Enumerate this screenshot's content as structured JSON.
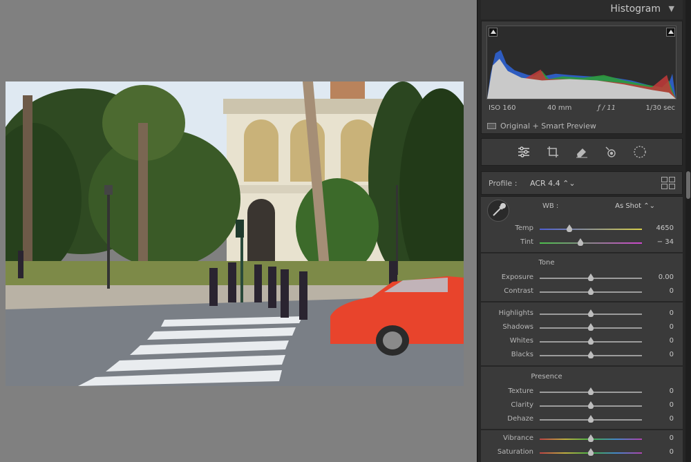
{
  "histogram": {
    "title": "Histogram",
    "iso": "ISO 160",
    "focal_length": "40 mm",
    "aperture": "ƒ / 11",
    "shutter": "1/30 sec",
    "preview_status": "Original + Smart Preview"
  },
  "tools": [
    {
      "name": "edit-sliders-icon"
    },
    {
      "name": "crop-icon"
    },
    {
      "name": "heal-eraser-icon"
    },
    {
      "name": "red-eye-icon"
    },
    {
      "name": "masking-icon"
    }
  ],
  "profile": {
    "label": "Profile :",
    "value": "ACR 4.4 ⌃⌄"
  },
  "wb": {
    "label": "WB :",
    "value": "As Shot ⌃⌄"
  },
  "groups": {
    "tone": "Tone",
    "presence": "Presence"
  },
  "sliders": {
    "temp": {
      "label": "Temp",
      "value": "4650",
      "position": 0.29
    },
    "tint": {
      "label": "Tint",
      "value": "− 34",
      "position": 0.4
    },
    "exposure": {
      "label": "Exposure",
      "value": "0.00",
      "position": 0.5
    },
    "contrast": {
      "label": "Contrast",
      "value": "0",
      "position": 0.5
    },
    "highlights": {
      "label": "Highlights",
      "value": "0",
      "position": 0.5
    },
    "shadows": {
      "label": "Shadows",
      "value": "0",
      "position": 0.5
    },
    "whites": {
      "label": "Whites",
      "value": "0",
      "position": 0.5
    },
    "blacks": {
      "label": "Blacks",
      "value": "0",
      "position": 0.5
    },
    "texture": {
      "label": "Texture",
      "value": "0",
      "position": 0.5
    },
    "clarity": {
      "label": "Clarity",
      "value": "0",
      "position": 0.5
    },
    "dehaze": {
      "label": "Dehaze",
      "value": "0",
      "position": 0.5
    },
    "vibrance": {
      "label": "Vibrance",
      "value": "0",
      "position": 0.5
    },
    "saturation": {
      "label": "Saturation",
      "value": "0",
      "position": 0.5
    }
  },
  "colors": {
    "panel_bg": "#3a3a3a",
    "canvas_bg": "#808080",
    "car": "#e8442c"
  }
}
